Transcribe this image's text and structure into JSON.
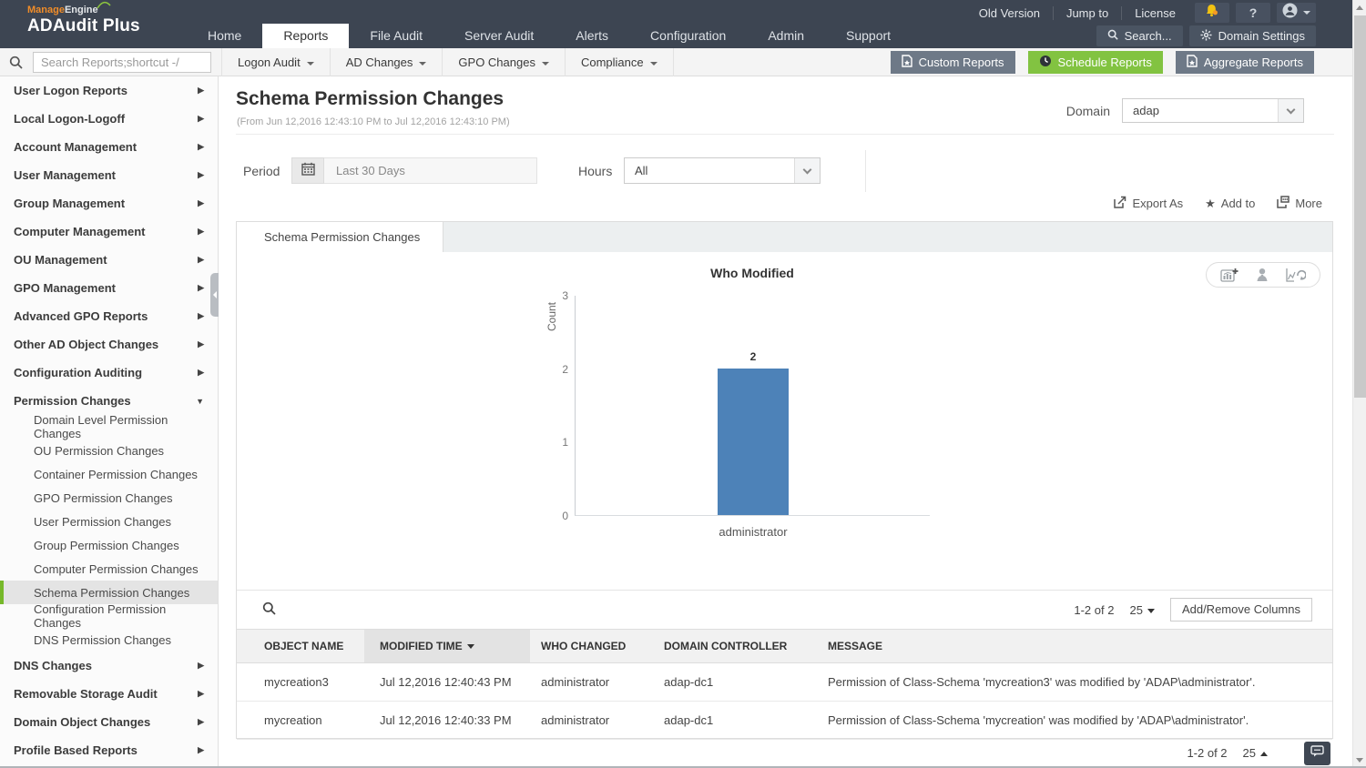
{
  "brand": {
    "manage": "Manage",
    "engine": "Engine",
    "product": "ADAudit Plus"
  },
  "header": {
    "nav": [
      "Home",
      "Reports",
      "File Audit",
      "Server Audit",
      "Alerts",
      "Configuration",
      "Admin",
      "Support"
    ],
    "active_tab": "Reports",
    "links": [
      "Old Version",
      "Jump to",
      "License"
    ],
    "help": "?",
    "search_label": "Search...",
    "domain_settings_label": "Domain Settings"
  },
  "toolbar": {
    "search_placeholder": "Search Reports;shortcut -/",
    "menus": [
      "Logon Audit",
      "AD Changes",
      "GPO Changes",
      "Compliance"
    ],
    "custom_reports": "Custom Reports",
    "schedule_reports": "Schedule Reports",
    "aggregate_reports": "Aggregate Reports"
  },
  "sidebar": {
    "top": [
      {
        "label": "User Logon Reports"
      },
      {
        "label": "Local Logon-Logoff"
      },
      {
        "label": "Account Management"
      },
      {
        "label": "User Management"
      },
      {
        "label": "Group Management"
      },
      {
        "label": "Computer Management"
      },
      {
        "label": "OU Management"
      },
      {
        "label": "GPO Management"
      },
      {
        "label": "Advanced GPO Reports"
      },
      {
        "label": "Other AD Object Changes"
      },
      {
        "label": "Configuration Auditing"
      },
      {
        "label": "Permission Changes"
      }
    ],
    "expanded_item": "Permission Changes",
    "permission_children": [
      {
        "label": "Domain Level Permission Changes"
      },
      {
        "label": "OU Permission Changes"
      },
      {
        "label": "Container Permission Changes"
      },
      {
        "label": "GPO Permission Changes"
      },
      {
        "label": "User Permission Changes"
      },
      {
        "label": "Group Permission Changes"
      },
      {
        "label": "Computer Permission Changes"
      },
      {
        "label": "Schema Permission Changes"
      },
      {
        "label": "Configuration Permission Changes"
      },
      {
        "label": "DNS Permission Changes"
      }
    ],
    "selected": "Schema Permission Changes",
    "bottom": [
      {
        "label": "DNS Changes"
      },
      {
        "label": "Removable Storage Audit"
      },
      {
        "label": "Domain Object Changes"
      },
      {
        "label": "Profile Based Reports"
      }
    ]
  },
  "report": {
    "title": "Schema Permission Changes",
    "date_range": "(From Jun 12,2016 12:43:10 PM to Jul 12,2016 12:43:10 PM)",
    "domain_label": "Domain",
    "domain_value": "adap",
    "period_label": "Period",
    "period_value": "Last 30 Days",
    "hours_label": "Hours",
    "hours_value": "All",
    "export_as": "Export As",
    "add_to": "Add to",
    "more": "More",
    "tab": "Schema Permission Changes"
  },
  "chart_data": {
    "type": "bar",
    "title": "Who Modified",
    "ylabel": "Count",
    "xlabel": "",
    "categories": [
      "administrator"
    ],
    "values": [
      2
    ],
    "yticks": [
      0,
      1,
      2,
      3
    ],
    "ylim": [
      0,
      3
    ],
    "bar_color": "#4d82b8",
    "grid": false,
    "legend": false
  },
  "table": {
    "columns": [
      "OBJECT NAME",
      "MODIFIED TIME",
      "WHO CHANGED",
      "DOMAIN CONTROLLER",
      "MESSAGE"
    ],
    "sorted_column": "MODIFIED TIME",
    "sort_direction": "desc",
    "rows": [
      [
        "mycreation3",
        "Jul 12,2016 12:40:43 PM",
        "administrator",
        "adap-dc1",
        "Permission of Class-Schema 'mycreation3' was modified by 'ADAP\\administrator'."
      ],
      [
        "mycreation",
        "Jul 12,2016 12:40:33 PM",
        "administrator",
        "adap-dc1",
        "Permission of Class-Schema 'mycreation' was modified by 'ADAP\\administrator'."
      ]
    ],
    "range": "1-2 of 2",
    "page_size": "25",
    "add_remove_columns": "Add/Remove Columns",
    "bottom_range": "1-2 of 2",
    "bottom_page_size": "25"
  },
  "colors": {
    "header": "#3d4552",
    "accent_green": "#82c341",
    "selected_green": "#76b82a",
    "bar": "#4d82b8"
  },
  "icons": {
    "search": "magnifier",
    "calendar": "calendar-grid",
    "bell": "bell-badge",
    "user": "person-circle",
    "gear": "gear",
    "star": "star",
    "export": "box-arrow-out",
    "more": "box-ellipsis",
    "clock": "clock",
    "chat": "speech-bubble",
    "chart_add": "bar-chart-plus",
    "chart_person": "person",
    "chart_refresh": "chart-refresh"
  }
}
